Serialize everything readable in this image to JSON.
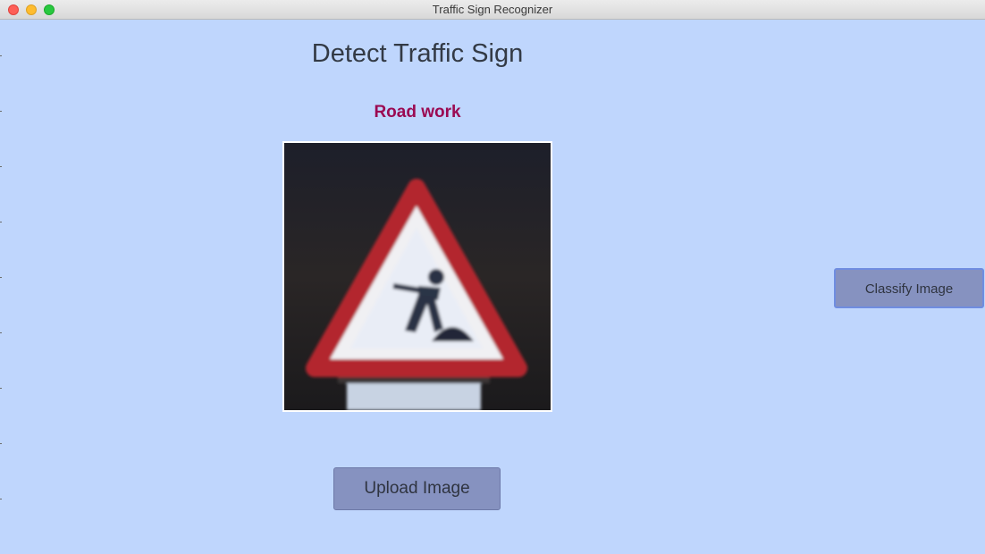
{
  "window": {
    "title": "Traffic Sign Recognizer"
  },
  "main": {
    "heading": "Detect Traffic Sign",
    "prediction": "Road work",
    "upload_label": "Upload Image",
    "classify_label": "Classify Image"
  },
  "colors": {
    "background": "#bfd6fd",
    "heading": "#333a45",
    "prediction": "#9b0a52",
    "button": "#8692c0",
    "sign_border": "#b3262f"
  },
  "icons": {
    "close": "close-dot",
    "minimize": "minimize-dot",
    "maximize": "maximize-dot"
  }
}
